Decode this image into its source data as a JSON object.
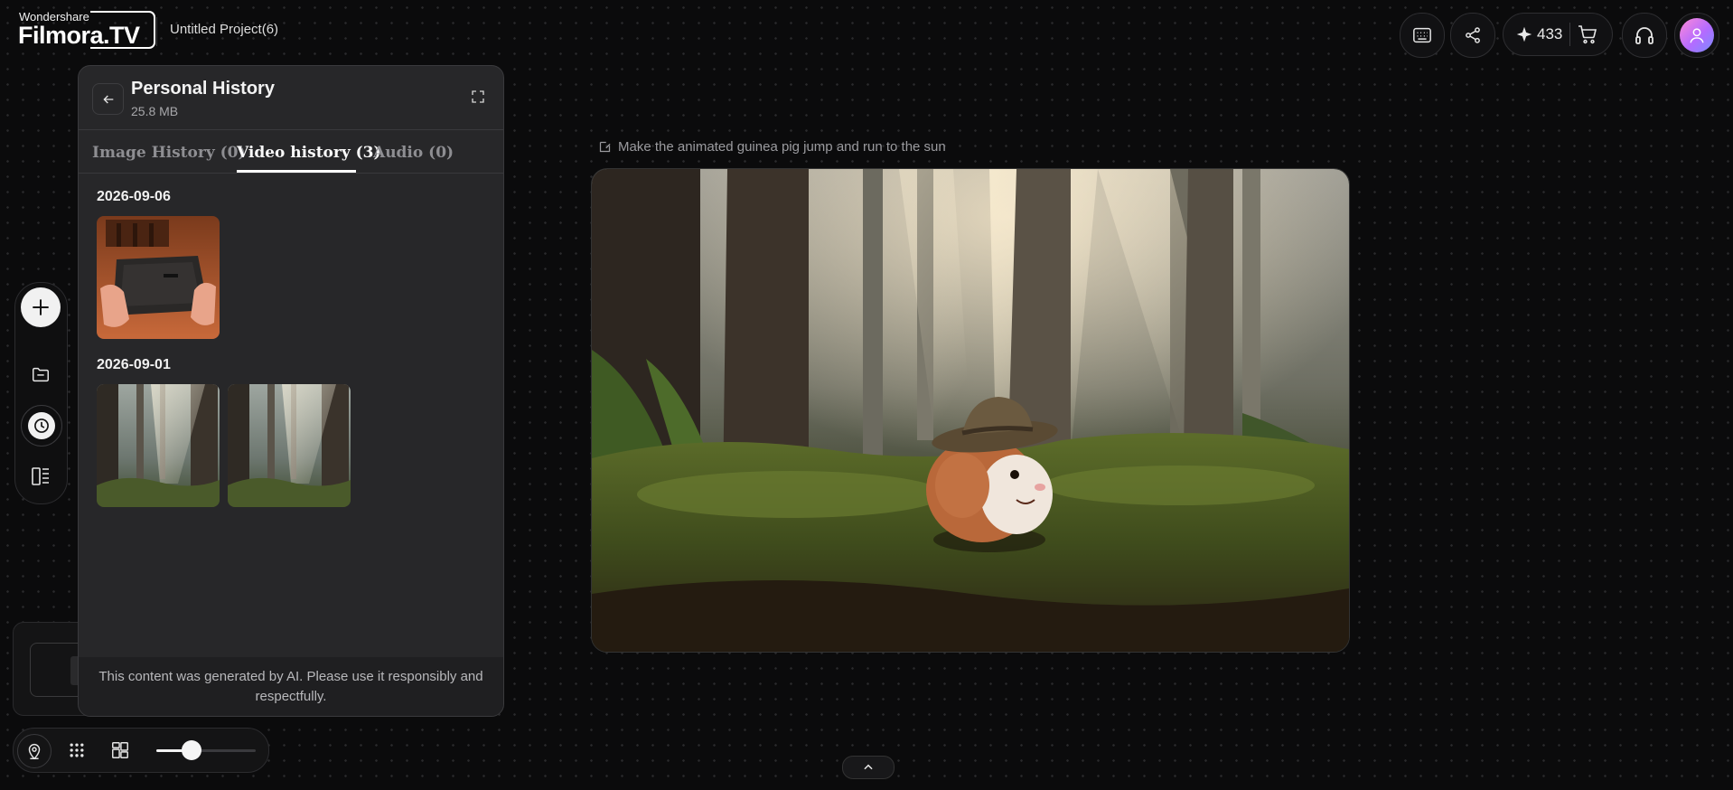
{
  "app": {
    "brand_small": "Wondershare",
    "brand_main": "Filmora.TV",
    "project_name": "Untitled Project(6)"
  },
  "topbar": {
    "credits": "433",
    "icons": [
      "keyboard-shortcuts-icon",
      "share-icon",
      "sparkle-icon",
      "cart-icon",
      "headset-icon",
      "avatar"
    ]
  },
  "panel": {
    "title": "Personal History",
    "size": "25.8 MB",
    "tabs": [
      {
        "label": "Image History (0)",
        "active": false
      },
      {
        "label": "Video history (3)",
        "active": true
      },
      {
        "label": "Audio (0)",
        "active": false
      }
    ],
    "groups": [
      {
        "date": "2026-09-06",
        "items": [
          "video-thumb-box"
        ]
      },
      {
        "date": "2026-09-01",
        "items": [
          "video-thumb-forest",
          "video-thumb-forest"
        ]
      }
    ],
    "footer": "This content was generated by AI. Please use it responsibly and respectfully."
  },
  "main": {
    "prompt": "Make the animated guinea pig jump and run to the sun"
  },
  "bottom": {
    "zoom_level": 0.35
  },
  "colors": {
    "background": "#0b0b0c",
    "panel": "#272729",
    "accent_avatar": "#c77dff"
  }
}
